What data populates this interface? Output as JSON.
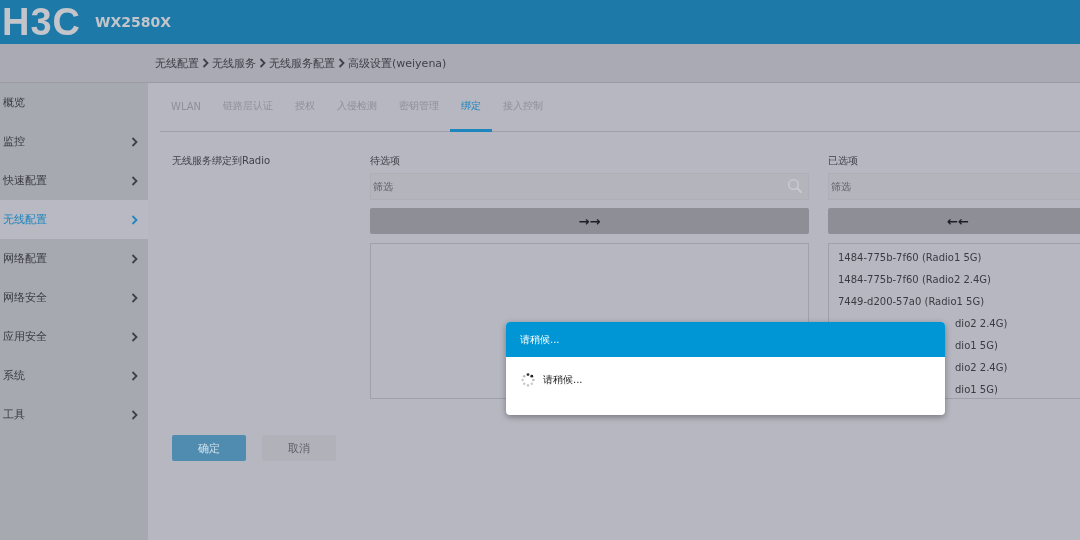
{
  "header": {
    "logo": "H3C",
    "model": "WX2580X"
  },
  "breadcrumb": [
    {
      "label": "无线配置"
    },
    {
      "label": "无线服务"
    },
    {
      "label": "无线服务配置"
    },
    {
      "label": "高级设置(weiyena)"
    }
  ],
  "sidebar": {
    "items": [
      {
        "label": "概览",
        "expandable": false,
        "selected": false
      },
      {
        "label": "监控",
        "expandable": true,
        "selected": false
      },
      {
        "label": "快速配置",
        "expandable": true,
        "selected": false
      },
      {
        "label": "无线配置",
        "expandable": true,
        "selected": true
      },
      {
        "label": "网络配置",
        "expandable": true,
        "selected": false
      },
      {
        "label": "网络安全",
        "expandable": true,
        "selected": false
      },
      {
        "label": "应用安全",
        "expandable": true,
        "selected": false
      },
      {
        "label": "系统",
        "expandable": true,
        "selected": false
      },
      {
        "label": "工具",
        "expandable": true,
        "selected": false
      }
    ]
  },
  "tabs": [
    {
      "label": "WLAN",
      "selected": false
    },
    {
      "label": "链路层认证",
      "selected": false
    },
    {
      "label": "授权",
      "selected": false
    },
    {
      "label": "入侵检测",
      "selected": false
    },
    {
      "label": "密钥管理",
      "selected": false
    },
    {
      "label": "绑定",
      "selected": true
    },
    {
      "label": "接入控制",
      "selected": false
    }
  ],
  "binding": {
    "label": "无线服务绑定到Radio",
    "available": {
      "title": "待选项",
      "filter_placeholder": "筛选",
      "move_button": "→→"
    },
    "selected": {
      "title": "已选项",
      "filter_placeholder": "筛选",
      "move_button": "←←",
      "items": [
        {
          "text": "1484-775b-7f60 (Radio1 5G)",
          "kind": "full"
        },
        {
          "text": "1484-775b-7f60 (Radio2 2.4G)",
          "kind": "full"
        },
        {
          "text": "7449-d200-57a0 (Radio1 5G)",
          "kind": "full"
        },
        {
          "text": "dio2 2.4G)",
          "kind": "clipped"
        },
        {
          "text": "dio1 5G)",
          "kind": "clipped"
        },
        {
          "text": "dio2 2.4G)",
          "kind": "clipped"
        },
        {
          "text": "dio1 5G)",
          "kind": "clipped"
        }
      ]
    }
  },
  "buttons": [
    {
      "label": "确定",
      "kind": "primary"
    },
    {
      "label": "取消",
      "kind": "secondary"
    }
  ],
  "dialog": {
    "title": "请稍候...",
    "message": "请稍候..."
  }
}
